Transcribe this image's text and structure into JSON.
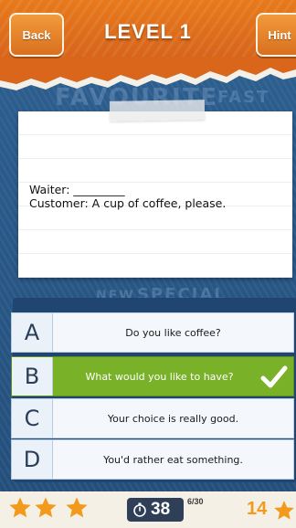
{
  "header": {
    "back_label": "Back",
    "title": "LEVEL 1",
    "hint_label": "Hint"
  },
  "background_words": [
    "FAVOURITE",
    "FAST",
    "SPECIAL",
    "NEW"
  ],
  "question": {
    "line1": "Waiter: _________",
    "line2": "Customer: A cup of coffee, please."
  },
  "answers": [
    {
      "letter": "A",
      "text": "Do you like coffee?",
      "selected": false
    },
    {
      "letter": "B",
      "text": "What would you like to have?",
      "selected": true
    },
    {
      "letter": "C",
      "text": "Your choice is really good.",
      "selected": false
    },
    {
      "letter": "D",
      "text": "You'd rather eat something.",
      "selected": false
    }
  ],
  "footer": {
    "stars": 3,
    "timer": "38",
    "progress": "6/30",
    "score": "14"
  },
  "colors": {
    "header_orange": "#d9661b",
    "denim_blue": "#2c5e8e",
    "correct_green": "#79b128",
    "star_orange": "#f29a1c",
    "timer_bg": "#2f3f58"
  }
}
